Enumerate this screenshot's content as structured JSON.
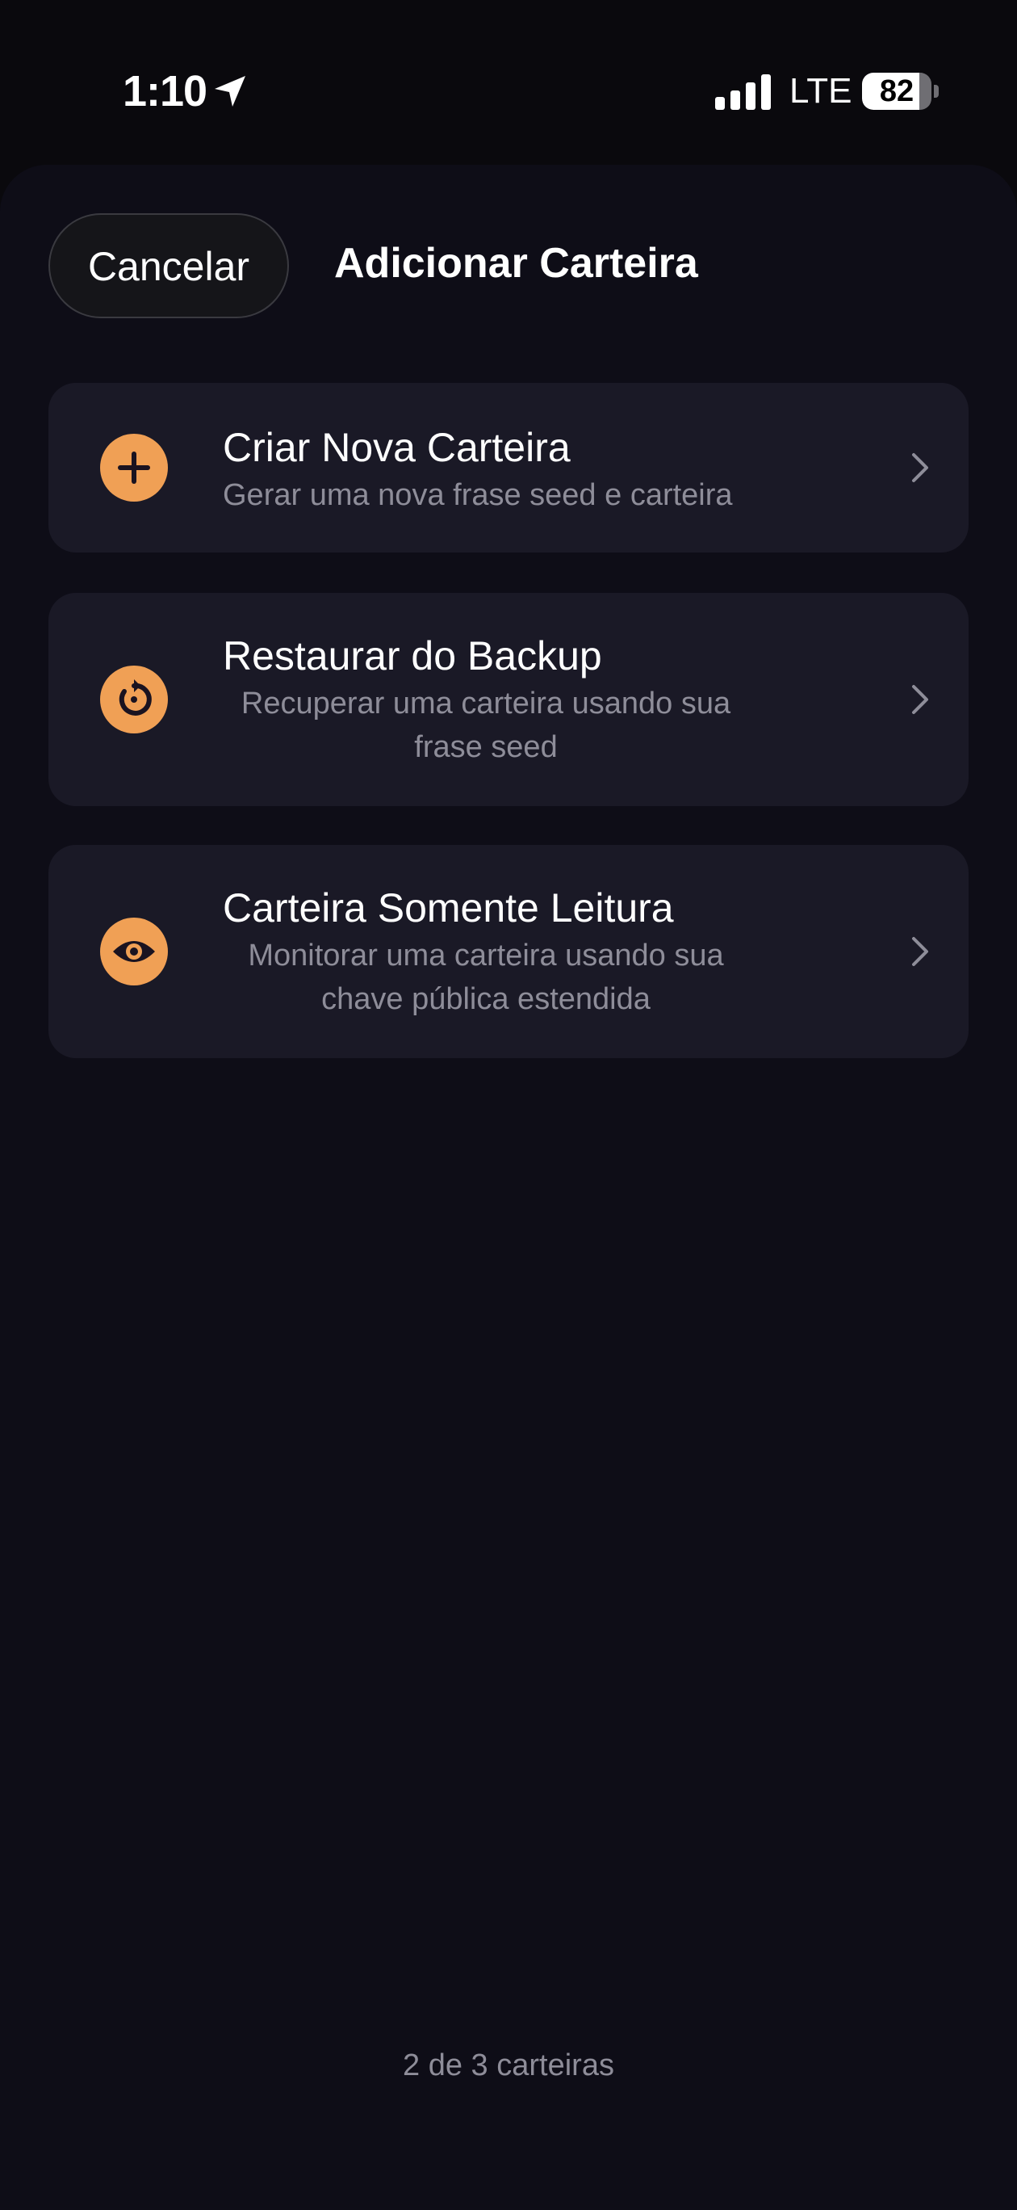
{
  "status_bar": {
    "time": "1:10",
    "network": "LTE",
    "battery_level": "82",
    "battery_fraction": 0.82,
    "icons": [
      "location-arrow-icon",
      "cellular-signal-icon",
      "battery-icon"
    ]
  },
  "header": {
    "cancel_label": "Cancelar",
    "title": "Adicionar Carteira"
  },
  "options": [
    {
      "title": "Criar Nova Carteira",
      "description": "Gerar uma nova frase seed e carteira",
      "icon": "plus-icon"
    },
    {
      "title": "Restaurar do Backup",
      "description": "Recuperar uma carteira usando sua frase seed",
      "icon": "restore-icon"
    },
    {
      "title": "Carteira Somente Leitura",
      "description": "Monitorar uma carteira usando sua chave pública estendida",
      "icon": "eye-icon"
    }
  ],
  "footer": {
    "wallet_count": "2 de 3 carteiras"
  },
  "colors": {
    "accent": "#f0a055",
    "background": "#0e0d17",
    "card": "#1a1926",
    "secondary_text": "#8e8d99"
  }
}
